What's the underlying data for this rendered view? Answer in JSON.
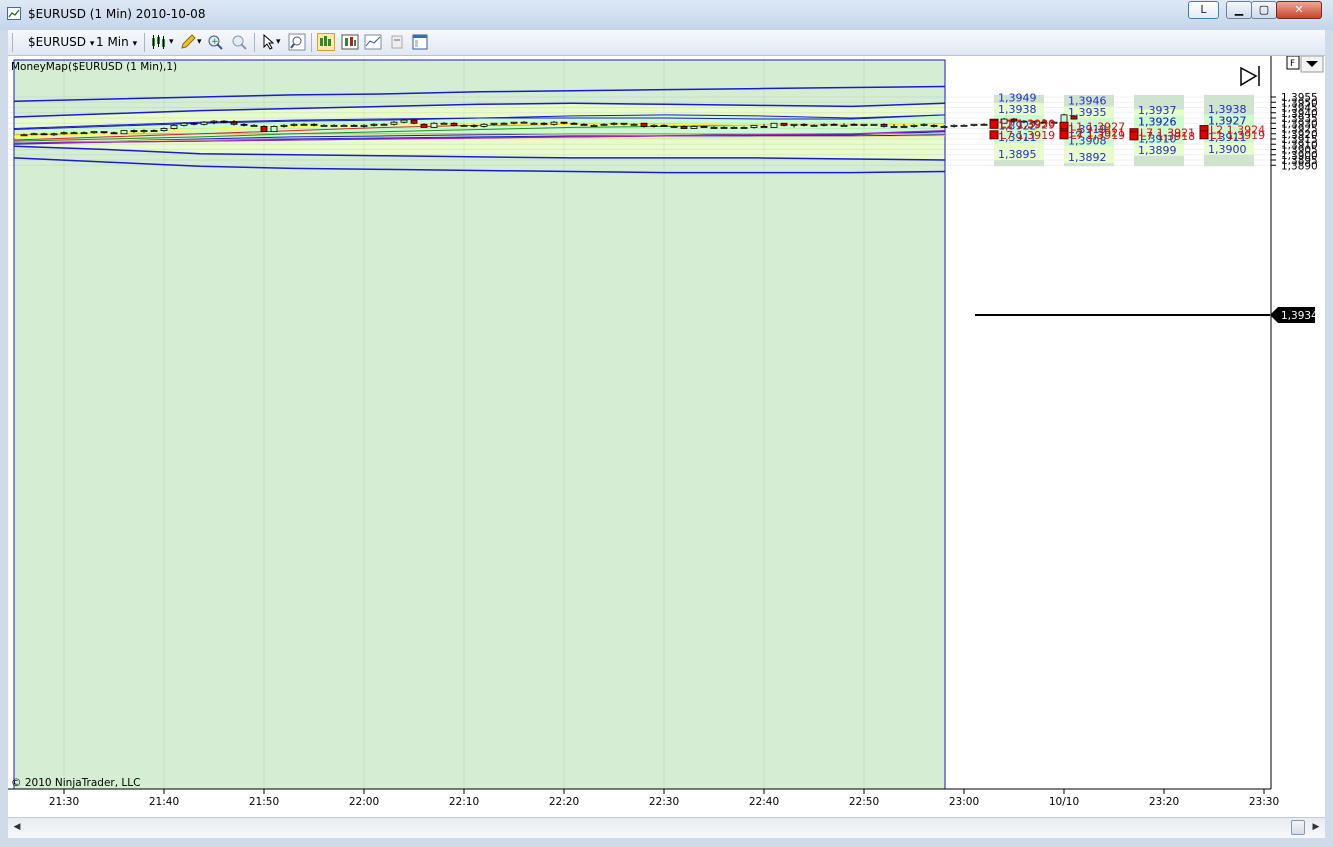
{
  "window": {
    "title": "$EURUSD (1 Min)  2010-10-08",
    "link_button": "L",
    "minimize_glyph": "▁",
    "maximize_glyph": "▢",
    "close_glyph": "✕",
    "icon": "chart-icon"
  },
  "toolbar": {
    "instrument": "$EURUSD",
    "interval": "1 Min",
    "dropdown_glyph": "▾",
    "icons": [
      "candlestick-style-icon",
      "pencil-draw-icon",
      "zoom-in-icon",
      "zoom-out-icon",
      "cursor-select-icon",
      "magnifier-icon",
      "chart-trader-icon",
      "strategies-icon",
      "indicators-icon",
      "templates-icon",
      "properties-icon"
    ]
  },
  "chart": {
    "indicator_label": "MoneyMap($EURUSD (1 Min),1)",
    "copyright": "© 2010 NinjaTrader, LLC",
    "current_price": "1,3934",
    "f_button": "F",
    "play_icon": "▷",
    "menu_glyph": "▾",
    "price_axis": [
      "1,3955",
      "1,3950",
      "1,3945",
      "1,3940",
      "1,3935",
      "1,3930",
      "1,3925",
      "1,3920",
      "1,3915",
      "1,3910",
      "1,3905",
      "1,3900",
      "1,3895",
      "1,3890"
    ],
    "time_axis": [
      "21:30",
      "21:40",
      "21:50",
      "22:00",
      "22:10",
      "22:20",
      "22:30",
      "22:40",
      "22:50",
      "23:00",
      "10/10",
      "23:20",
      "23:30"
    ],
    "projection_columns": [
      {
        "blue_labels": [
          "1,3949",
          "1,3938",
          "1,3922",
          "1,3911",
          "1,3895"
        ],
        "red_labels": [
          "L1 1,3930",
          "L2 1,3929",
          "L7 1,3919"
        ]
      },
      {
        "blue_labels": [
          "1,3946",
          "1,3935",
          "1,3919",
          "1,3908",
          "1,3892"
        ],
        "red_labels": [
          "L1 1,3927",
          "L2 1,3921",
          "L7 1,3919"
        ]
      },
      {
        "blue_labels": [
          "1,3926",
          "1,3937",
          "1,3926",
          "1,3910",
          "1,3899"
        ],
        "red_labels": [
          "L7 1,3921",
          "L7 1,3918"
        ]
      },
      {
        "blue_labels": [
          "1,3927",
          "1,3938",
          "1,3927",
          "1,3911",
          "1,3900"
        ],
        "red_labels": [
          "L2 1,3924",
          "L1 1,3919"
        ]
      }
    ]
  },
  "chart_data": {
    "type": "candlestick",
    "price_range": [
      1.3889,
      1.3957
    ],
    "candles": [
      [
        1.3919,
        1.392,
        1.3918,
        1.3919
      ],
      [
        1.392,
        1.3921,
        1.3919,
        1.392
      ],
      [
        1.392,
        1.3921,
        1.3919,
        1.3919
      ],
      [
        1.3919,
        1.3921,
        1.3918,
        1.392
      ],
      [
        1.392,
        1.3922,
        1.3919,
        1.3921
      ],
      [
        1.3921,
        1.3922,
        1.392,
        1.3921
      ],
      [
        1.3921,
        1.3922,
        1.392,
        1.3921
      ],
      [
        1.3921,
        1.3922,
        1.392,
        1.3922
      ],
      [
        1.3922,
        1.3922,
        1.392,
        1.3921
      ],
      [
        1.3921,
        1.3922,
        1.392,
        1.392
      ],
      [
        1.392,
        1.3923,
        1.392,
        1.3923
      ],
      [
        1.3923,
        1.3924,
        1.3921,
        1.3922
      ],
      [
        1.3922,
        1.3924,
        1.3921,
        1.3923
      ],
      [
        1.3923,
        1.3924,
        1.3922,
        1.3923
      ],
      [
        1.3923,
        1.3926,
        1.3922,
        1.3925
      ],
      [
        1.3925,
        1.3929,
        1.3924,
        1.3928
      ],
      [
        1.3928,
        1.3931,
        1.3927,
        1.393
      ],
      [
        1.393,
        1.3931,
        1.3928,
        1.3929
      ],
      [
        1.3929,
        1.3932,
        1.3928,
        1.3931
      ],
      [
        1.3931,
        1.3933,
        1.3929,
        1.3932
      ],
      [
        1.3932,
        1.3933,
        1.393,
        1.3931
      ],
      [
        1.3931,
        1.3933,
        1.3928,
        1.3929
      ],
      [
        1.3929,
        1.393,
        1.3927,
        1.3928
      ],
      [
        1.3928,
        1.3929,
        1.3927,
        1.3928
      ],
      [
        1.3927,
        1.3928,
        1.3922,
        1.3922
      ],
      [
        1.3922,
        1.3928,
        1.3922,
        1.3927
      ],
      [
        1.3927,
        1.3929,
        1.3926,
        1.3928
      ],
      [
        1.3928,
        1.393,
        1.3927,
        1.3929
      ],
      [
        1.3929,
        1.393,
        1.3928,
        1.3929
      ],
      [
        1.3929,
        1.393,
        1.3927,
        1.3928
      ],
      [
        1.3928,
        1.3929,
        1.3927,
        1.3928
      ],
      [
        1.3928,
        1.3929,
        1.3927,
        1.3928
      ],
      [
        1.3928,
        1.3929,
        1.3927,
        1.3928
      ],
      [
        1.3928,
        1.3929,
        1.3927,
        1.3927
      ],
      [
        1.3927,
        1.3929,
        1.3926,
        1.3928
      ],
      [
        1.3928,
        1.393,
        1.3927,
        1.3929
      ],
      [
        1.3929,
        1.393,
        1.3928,
        1.3929
      ],
      [
        1.3929,
        1.3932,
        1.3928,
        1.3931
      ],
      [
        1.3931,
        1.3934,
        1.393,
        1.3933
      ],
      [
        1.3933,
        1.3933,
        1.3929,
        1.393
      ],
      [
        1.3929,
        1.393,
        1.3926,
        1.3926
      ],
      [
        1.3926,
        1.3931,
        1.3926,
        1.393
      ],
      [
        1.393,
        1.3931,
        1.3929,
        1.393
      ],
      [
        1.393,
        1.3931,
        1.3927,
        1.3928
      ],
      [
        1.3928,
        1.3929,
        1.3927,
        1.3928
      ],
      [
        1.3928,
        1.3929,
        1.3926,
        1.3927
      ],
      [
        1.3927,
        1.393,
        1.3926,
        1.3929
      ],
      [
        1.3929,
        1.393,
        1.3928,
        1.393
      ],
      [
        1.393,
        1.3931,
        1.3929,
        1.393
      ],
      [
        1.393,
        1.3931,
        1.3929,
        1.3931
      ],
      [
        1.3931,
        1.3932,
        1.393,
        1.3931
      ],
      [
        1.393,
        1.3931,
        1.3929,
        1.393
      ],
      [
        1.393,
        1.3931,
        1.3928,
        1.3929
      ],
      [
        1.3929,
        1.3932,
        1.3928,
        1.3931
      ],
      [
        1.3931,
        1.3931,
        1.3929,
        1.393
      ],
      [
        1.393,
        1.3931,
        1.3929,
        1.3929
      ],
      [
        1.3929,
        1.393,
        1.3928,
        1.3928
      ],
      [
        1.3928,
        1.3929,
        1.3928,
        1.3928
      ],
      [
        1.3929,
        1.393,
        1.3928,
        1.3929
      ],
      [
        1.393,
        1.3931,
        1.3928,
        1.393
      ],
      [
        1.393,
        1.393,
        1.3928,
        1.393
      ],
      [
        1.3929,
        1.393,
        1.3928,
        1.3929
      ],
      [
        1.393,
        1.393,
        1.3926,
        1.3927
      ],
      [
        1.3927,
        1.3929,
        1.3926,
        1.3928
      ],
      [
        1.3928,
        1.3929,
        1.3927,
        1.3927
      ],
      [
        1.3927,
        1.3928,
        1.3926,
        1.3927
      ],
      [
        1.3927,
        1.3928,
        1.3925,
        1.3925
      ],
      [
        1.3925,
        1.3928,
        1.3925,
        1.3927
      ],
      [
        1.3927,
        1.3927,
        1.3926,
        1.3926
      ],
      [
        1.3926,
        1.3927,
        1.3925,
        1.3926
      ],
      [
        1.3926,
        1.3927,
        1.3925,
        1.3926
      ],
      [
        1.3926,
        1.3927,
        1.3925,
        1.3926
      ],
      [
        1.3926,
        1.3927,
        1.3925,
        1.3926
      ],
      [
        1.3926,
        1.3928,
        1.3925,
        1.3928
      ],
      [
        1.3927,
        1.3929,
        1.3926,
        1.3926
      ],
      [
        1.3926,
        1.393,
        1.3926,
        1.393
      ],
      [
        1.393,
        1.393,
        1.3927,
        1.3928
      ],
      [
        1.3928,
        1.3929,
        1.3926,
        1.3929
      ],
      [
        1.3929,
        1.393,
        1.3927,
        1.3928
      ],
      [
        1.3928,
        1.3929,
        1.3927,
        1.3928
      ],
      [
        1.3928,
        1.393,
        1.3927,
        1.3929
      ],
      [
        1.3929,
        1.393,
        1.3928,
        1.3928
      ],
      [
        1.3928,
        1.393,
        1.3927,
        1.3928
      ],
      [
        1.3929,
        1.393,
        1.3928,
        1.3928
      ],
      [
        1.3928,
        1.3929,
        1.3927,
        1.3929
      ],
      [
        1.3928,
        1.3929,
        1.3928,
        1.3929
      ],
      [
        1.3929,
        1.393,
        1.3926,
        1.3927
      ],
      [
        1.3927,
        1.3929,
        1.3926,
        1.3927
      ],
      [
        1.3927,
        1.3929,
        1.3926,
        1.3927
      ],
      [
        1.3927,
        1.3929,
        1.3926,
        1.3928
      ],
      [
        1.3928,
        1.393,
        1.3927,
        1.3929
      ],
      [
        1.3928,
        1.3929,
        1.3926,
        1.3927
      ],
      [
        1.3927,
        1.3928,
        1.3927,
        1.3927
      ],
      [
        1.3927,
        1.3929,
        1.3926,
        1.3928
      ],
      [
        1.3928,
        1.3929,
        1.3927,
        1.3928
      ],
      [
        1.3928,
        1.3929,
        1.3927,
        1.3929
      ],
      [
        1.3929,
        1.393,
        1.3928,
        1.3929
      ],
      [
        1.3929,
        1.393,
        1.3927,
        1.3929
      ],
      [
        1.393,
        1.3935,
        1.393,
        1.3934
      ],
      [
        1.3934,
        1.3935,
        1.393,
        1.3932
      ],
      [
        1.3932,
        1.3933,
        1.393,
        1.3932
      ],
      [
        1.3932,
        1.3932,
        1.3929,
        1.3931
      ],
      [
        1.3931,
        1.3934,
        1.393,
        1.393
      ],
      [
        1.393,
        1.3932,
        1.3929,
        1.3931
      ],
      [
        1.3931,
        1.3939,
        1.3931,
        1.3938
      ],
      [
        1.3937,
        1.3938,
        1.3934,
        1.3934
      ]
    ],
    "bands": {
      "b_top": [
        1.3951,
        1.3953,
        1.3955,
        1.3957,
        1.3958,
        1.396,
        1.3961,
        1.3962,
        1.3963,
        1.3964,
        1.3965
      ],
      "b_u2": [
        1.3936,
        1.3939,
        1.3942,
        1.3944,
        1.3946,
        1.3948,
        1.3949,
        1.3948,
        1.3947,
        1.3946,
        1.3949
      ],
      "b_u1": [
        1.3924,
        1.3927,
        1.393,
        1.3932,
        1.3933,
        1.3935,
        1.3937,
        1.3938,
        1.3937,
        1.3935,
        1.3938
      ],
      "b_l1": [
        1.3911,
        1.3912,
        1.3914,
        1.3915,
        1.3916,
        1.3917,
        1.3918,
        1.3918,
        1.3918,
        1.3918,
        1.3919
      ],
      "b_l2": [
        1.3908,
        1.3905,
        1.3901,
        1.39,
        1.3899,
        1.3898,
        1.3897,
        1.3897,
        1.3897,
        1.3896,
        1.3895
      ],
      "b_bot": [
        1.3897,
        1.3893,
        1.3889,
        1.3887,
        1.3886,
        1.3885,
        1.3884,
        1.3883,
        1.3883,
        1.3883,
        1.3884
      ],
      "blue_upper": [
        1.3925,
        1.3928,
        1.3931,
        1.3933,
        1.3934,
        1.3935,
        1.3935,
        1.3935,
        1.3934,
        1.3934,
        1.3938
      ],
      "blue_lower": [
        1.391,
        1.3912,
        1.3913,
        1.3914,
        1.3915,
        1.3916,
        1.3917,
        1.3918,
        1.3919,
        1.3919,
        1.3922
      ],
      "blue_mid": [
        1.3911,
        1.3913,
        1.3915,
        1.3917,
        1.3918,
        1.3919,
        1.392,
        1.392,
        1.3919,
        1.3919,
        1.3922
      ],
      "yellow": [
        1.3917,
        1.392,
        1.3924,
        1.3927,
        1.3928,
        1.3929,
        1.3929,
        1.3929,
        1.3928,
        1.3928,
        1.3929
      ],
      "red": [
        1.3914,
        1.3917,
        1.392,
        1.3923,
        1.3926,
        1.3928,
        1.3929,
        1.3929,
        1.3928,
        1.3928,
        1.3929
      ],
      "green": [
        1.3913,
        1.3915,
        1.3917,
        1.392,
        1.3922,
        1.3924,
        1.3926,
        1.3927,
        1.3928,
        1.3928,
        1.3929
      ],
      "purple": [
        1.3911,
        1.3912,
        1.3913,
        1.3914,
        1.3915,
        1.3916,
        1.3917,
        1.3918,
        1.3919,
        1.392,
        1.3923
      ],
      "orange": [
        1.3919,
        1.392,
        1.392,
        1.392,
        1.392,
        1.392,
        1.392,
        1.392,
        1.392,
        1.392,
        1.392
      ],
      "khaki": [
        1.3913,
        1.3913,
        1.3914,
        1.3914,
        1.3915,
        1.3915,
        1.3916,
        1.3916,
        1.3917,
        1.3917,
        1.3918
      ]
    },
    "projection_prices": [
      {
        "tiers": [
          1.3957,
          1.3949,
          1.3938,
          1.3922,
          1.3911,
          1.3895,
          1.3889
        ],
        "markers": [
          1.393,
          1.3929,
          1.3919
        ]
      },
      {
        "tiers": [
          1.3957,
          1.3946,
          1.3935,
          1.3919,
          1.3908,
          1.3892,
          1.3889
        ],
        "markers": [
          1.3927,
          1.3921,
          1.3919
        ]
      },
      {
        "tiers": [
          1.3957,
          1.3943,
          1.3937,
          1.3926,
          1.391,
          1.3899,
          1.3889
        ],
        "markers": [
          1.3921,
          1.3918
        ]
      },
      {
        "tiers": [
          1.3957,
          1.3938,
          1.3938,
          1.3927,
          1.3911,
          1.39,
          1.3889
        ],
        "markers": [
          1.3924,
          1.3919
        ]
      }
    ],
    "colors": {
      "zone_outer": "#d5eed3",
      "zone_mid": "#e8fbcc",
      "zone_inner": "#ccfbd0",
      "zone_outer_proj": "#cfe3cf",
      "band_line": "#1a1ad0",
      "up_candle": "#ccf7cc",
      "down_candle": "#e00000",
      "yellow": "#ffff44",
      "red_ma": "#e02020",
      "green_ma": "#228b22",
      "purple": "#a020c0",
      "orange": "#ffa500",
      "khaki": "#f0e08c"
    }
  }
}
